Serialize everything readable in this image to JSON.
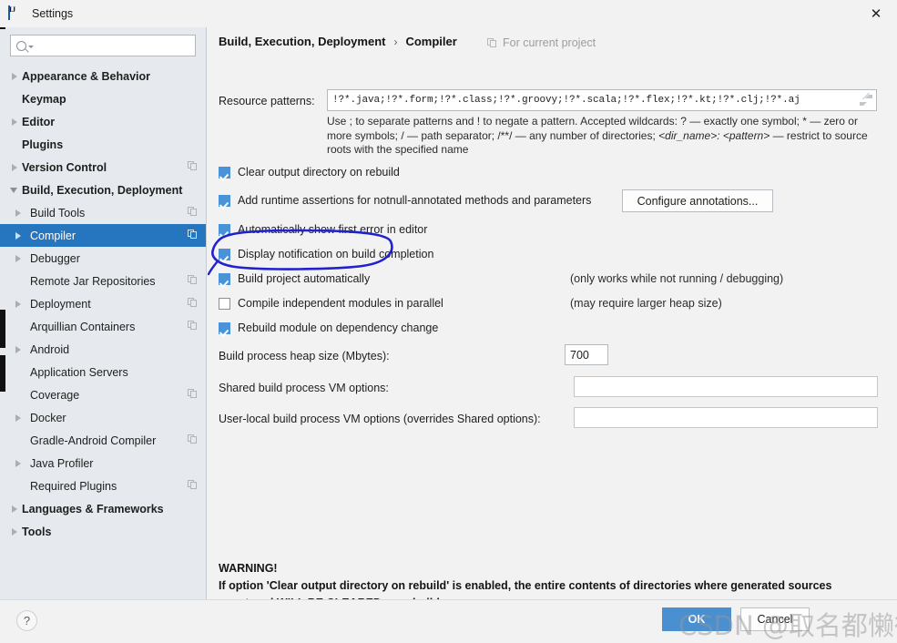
{
  "window": {
    "title": "Settings",
    "icon": "intellij-icon",
    "close_label": "✕"
  },
  "sidebar": {
    "search": {
      "value": "",
      "placeholder": ""
    },
    "items": [
      {
        "label": "Appearance & Behavior",
        "level": 0,
        "bold": true,
        "twisty": "right",
        "copy": false,
        "selected": false
      },
      {
        "label": "Keymap",
        "level": 0,
        "bold": true,
        "twisty": "none",
        "copy": false,
        "selected": false
      },
      {
        "label": "Editor",
        "level": 0,
        "bold": true,
        "twisty": "right",
        "copy": false,
        "selected": false
      },
      {
        "label": "Plugins",
        "level": 0,
        "bold": true,
        "twisty": "none",
        "copy": false,
        "selected": false
      },
      {
        "label": "Version Control",
        "level": 0,
        "bold": true,
        "twisty": "right",
        "copy": true,
        "selected": false
      },
      {
        "label": "Build, Execution, Deployment",
        "level": 0,
        "bold": true,
        "twisty": "down",
        "copy": false,
        "selected": false
      },
      {
        "label": "Build Tools",
        "level": 1,
        "bold": false,
        "twisty": "right",
        "copy": true,
        "selected": false
      },
      {
        "label": "Compiler",
        "level": 1,
        "bold": false,
        "twisty": "right",
        "copy": true,
        "selected": true
      },
      {
        "label": "Debugger",
        "level": 1,
        "bold": false,
        "twisty": "right",
        "copy": false,
        "selected": false
      },
      {
        "label": "Remote Jar Repositories",
        "level": 1,
        "bold": false,
        "twisty": "none",
        "copy": true,
        "selected": false
      },
      {
        "label": "Deployment",
        "level": 1,
        "bold": false,
        "twisty": "right",
        "copy": true,
        "selected": false
      },
      {
        "label": "Arquillian Containers",
        "level": 1,
        "bold": false,
        "twisty": "none",
        "copy": true,
        "selected": false
      },
      {
        "label": "Android",
        "level": 1,
        "bold": false,
        "twisty": "right",
        "copy": false,
        "selected": false
      },
      {
        "label": "Application Servers",
        "level": 1,
        "bold": false,
        "twisty": "none",
        "copy": false,
        "selected": false
      },
      {
        "label": "Coverage",
        "level": 1,
        "bold": false,
        "twisty": "none",
        "copy": true,
        "selected": false
      },
      {
        "label": "Docker",
        "level": 1,
        "bold": false,
        "twisty": "right",
        "copy": false,
        "selected": false
      },
      {
        "label": "Gradle-Android Compiler",
        "level": 1,
        "bold": false,
        "twisty": "none",
        "copy": true,
        "selected": false
      },
      {
        "label": "Java Profiler",
        "level": 1,
        "bold": false,
        "twisty": "right",
        "copy": false,
        "selected": false
      },
      {
        "label": "Required Plugins",
        "level": 1,
        "bold": false,
        "twisty": "none",
        "copy": true,
        "selected": false
      },
      {
        "label": "Languages & Frameworks",
        "level": 0,
        "bold": true,
        "twisty": "right",
        "copy": false,
        "selected": false
      },
      {
        "label": "Tools",
        "level": 0,
        "bold": true,
        "twisty": "right",
        "copy": false,
        "selected": false
      }
    ]
  },
  "header": {
    "breadcrumb_parent": "Build, Execution, Deployment",
    "breadcrumb_separator": "›",
    "breadcrumb_current": "Compiler",
    "scope_label": "For current project",
    "scope_icon": "project-scope-icon"
  },
  "main": {
    "resource_patterns": {
      "label": "Resource patterns:",
      "value": "!?*.java;!?*.form;!?*.class;!?*.groovy;!?*.scala;!?*.flex;!?*.kt;!?*.clj;!?*.aj",
      "placeholder": "",
      "expand_icon": "expand-arrows-icon"
    },
    "hint_line1": "Use ; to separate patterns and ! to negate a pattern. Accepted wildcards: ? — exactly one symbol; * — zero or",
    "hint_line2a": "more symbols; / — path separator; /**/ — any number of directories;  ",
    "hint_line2b": "<dir_name>: <pattern>",
    "hint_line2c": " — restrict to source",
    "hint_line3": "roots with the specified name",
    "checkboxes": [
      {
        "label": "Clear output directory on rebuild",
        "checked": true
      },
      {
        "label": "Add runtime assertions for notnull-annotated methods and parameters",
        "checked": true
      },
      {
        "label": "Automatically show first error in editor",
        "checked": true
      },
      {
        "label": "Display notification on build completion",
        "checked": true
      },
      {
        "label": "Build project automatically",
        "checked": true
      },
      {
        "label": "Compile independent modules in parallel",
        "checked": false
      },
      {
        "label": "Rebuild module on dependency change",
        "checked": true
      }
    ],
    "configure_annotations_label": "Configure annotations...",
    "hint_autobuild": "(only works while not running / debugging)",
    "hint_parallel": "(may require larger heap size)",
    "heap": {
      "label": "Build process heap size (Mbytes):",
      "value": "700"
    },
    "shared_vm": {
      "label": "Shared build process VM options:",
      "value": "",
      "placeholder": ""
    },
    "userlocal_vm": {
      "label": "User-local build process VM options (overrides Shared options):",
      "value": "",
      "placeholder": ""
    },
    "warning_title": "WARNING!",
    "warning_line1": "If option 'Clear output directory on rebuild' is enabled, the entire contents of directories where generated sources",
    "warning_line2": "are stored WILL BE CLEARED on rebuild."
  },
  "footer": {
    "help_label": "?",
    "ok_label": "OK",
    "cancel_label": "Cancel"
  },
  "overlay": {
    "annotation_shape": "hand-drawn-blue-ellipse",
    "annotation_color": "#2222cc",
    "watermark_text": "CSDN @取名都懒得取"
  },
  "colors": {
    "accent": "#2675bf",
    "checkbox": "#4a93d9",
    "ok_button": "#4a8fd0",
    "sidebar_bg": "#e6eaee",
    "content_bg": "#f2f2f2"
  }
}
